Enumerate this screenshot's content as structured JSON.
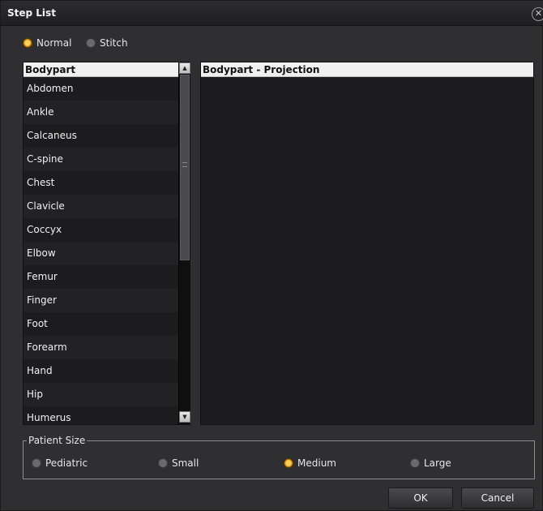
{
  "window": {
    "title": "Step List",
    "close_glyph": "✕"
  },
  "mode": {
    "options": [
      "Normal",
      "Stitch"
    ],
    "selected": "Normal"
  },
  "bodypart_list": {
    "header": "Bodypart",
    "items": [
      "Abdomen",
      "Ankle",
      "Calcaneus",
      "C-spine",
      "Chest",
      "Clavicle",
      "Coccyx",
      "Elbow",
      "Femur",
      "Finger",
      "Foot",
      "Forearm",
      "Hand",
      "Hip",
      "Humerus"
    ]
  },
  "projection_list": {
    "header": "Bodypart - Projection",
    "items": []
  },
  "scrollbar": {
    "up_glyph": "▲",
    "down_glyph": "▼"
  },
  "patient_size": {
    "legend": "Patient Size",
    "options": [
      "Pediatric",
      "Small",
      "Medium",
      "Large"
    ],
    "selected": "Medium"
  },
  "buttons": {
    "ok": "OK",
    "cancel": "Cancel"
  },
  "colors": {
    "accent_radio": "#e29a12",
    "background": "#2f2f31",
    "list_bg": "#1c1c1e",
    "header_bg": "#f0f0f0"
  }
}
